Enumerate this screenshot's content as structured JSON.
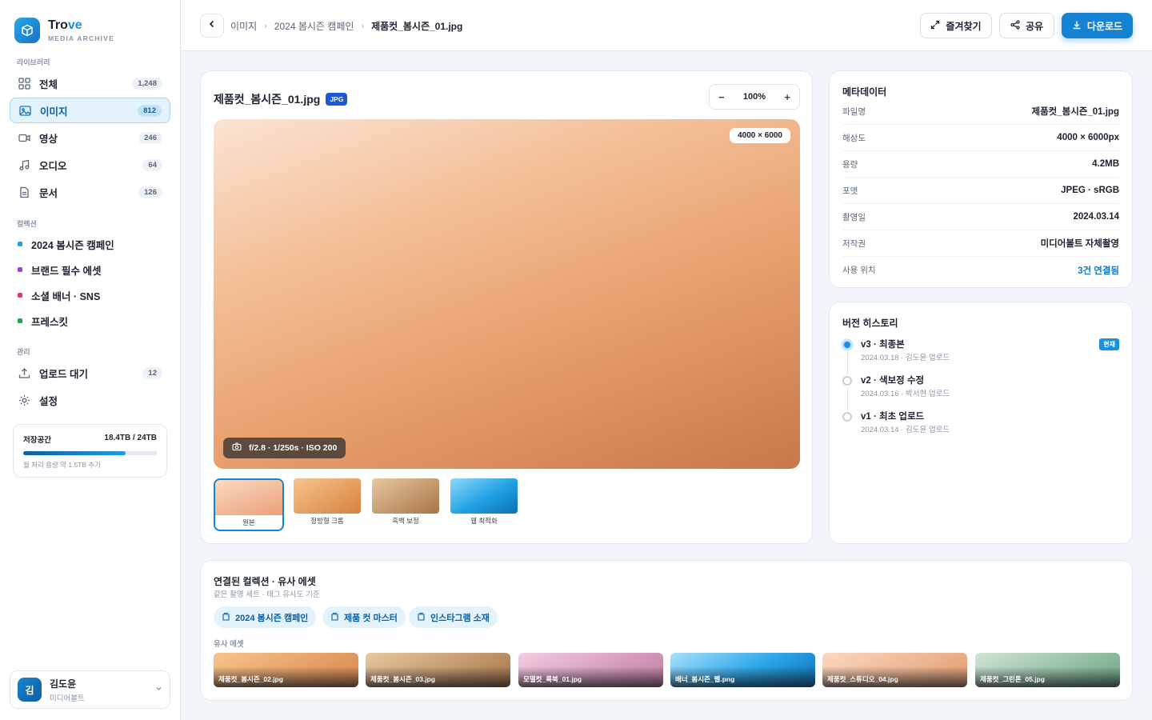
{
  "brand": {
    "name_main": "Tro",
    "name_accent": "ve",
    "sub": "MEDIA ARCHIVE"
  },
  "sidebar": {
    "library_label": "라이브러리",
    "library": [
      {
        "label": "전체",
        "count": "1,248",
        "icon": "grid-icon"
      },
      {
        "label": "이미지",
        "count": "812",
        "icon": "image-icon",
        "active": true
      },
      {
        "label": "영상",
        "count": "246",
        "icon": "video-icon"
      },
      {
        "label": "오디오",
        "count": "64",
        "icon": "music-icon"
      },
      {
        "label": "문서",
        "count": "126",
        "icon": "document-icon"
      }
    ],
    "collections_label": "컬렉션",
    "collections": [
      {
        "label": "2024 봄시즌 캠페인",
        "color": "#1ba3d8"
      },
      {
        "label": "브랜드 필수 에셋",
        "color": "#9b3fd6"
      },
      {
        "label": "소셜 배너 · SNS",
        "color": "#e0357a"
      },
      {
        "label": "프레스킷",
        "color": "#22a34a"
      }
    ],
    "manage_label": "관리",
    "manage": [
      {
        "label": "업로드 대기",
        "count": "12",
        "icon": "upload-icon"
      },
      {
        "label": "설정",
        "icon": "settings-icon"
      }
    ],
    "storage": {
      "title": "저장공간",
      "value": "18.4TB / 24TB",
      "used_fraction": 0.767,
      "note": "월 처리 용량 약 1.5TB 추가"
    },
    "user": {
      "initial": "김",
      "name": "김도윤",
      "org": "미디어볼트"
    }
  },
  "topbar": {
    "breadcrumb": [
      "이미지",
      "2024 봄시즌 캠페인",
      "제품컷_봄시즌_01.jpg"
    ],
    "favorite_label": "즐겨찾기",
    "share_label": "공유",
    "download_label": "다운로드"
  },
  "preview": {
    "title": "제품컷_봄시즌_01.jpg",
    "format_chip": "JPG",
    "zoom": "100%",
    "zoom_minus": "−",
    "zoom_plus": "+",
    "resolution": "4000 × 6000",
    "exif": "f/2.8 · 1/250s · ISO 200",
    "thumbnails": [
      {
        "label": "원본",
        "active": true
      },
      {
        "label": "정방형 크롭"
      },
      {
        "label": "흑백 보정"
      },
      {
        "label": "웹 최적화"
      }
    ]
  },
  "metadata": {
    "title": "메타데이터",
    "rows": [
      {
        "key": "파일명",
        "value": "제품컷_봄시즌_01.jpg"
      },
      {
        "key": "해상도",
        "value": "4000 × 6000px"
      },
      {
        "key": "용량",
        "value": "4.2MB"
      },
      {
        "key": "포맷",
        "value": "JPEG · sRGB"
      },
      {
        "key": "촬영일",
        "value": "2024.03.14"
      },
      {
        "key": "저작권",
        "value": "미디어볼트 자체촬영"
      },
      {
        "key": "사용 위치",
        "value": "3건 연결됨"
      }
    ]
  },
  "versions": {
    "title": "버전 히스토리",
    "items": [
      {
        "title": "v3 · 최종본",
        "sub": "2024.03.18 · 김도윤 업로드",
        "tag": "현재"
      },
      {
        "title": "v2 · 색보정 수정",
        "sub": "2024.03.16 · 박서현 업로드"
      },
      {
        "title": "v1 · 최초 업로드",
        "sub": "2024.03.14 · 김도윤 업로드"
      }
    ]
  },
  "related": {
    "title": "연결된 컬렉션 · 유사 에셋",
    "sub": "같은 촬영 세트 · 태그 유사도 기준",
    "collections": [
      "2024 봄시즌 캠페인",
      "제품 컷 마스터",
      "인스타그램 소재"
    ],
    "similar_label": "유사 에셋",
    "assets": [
      {
        "label": "제품컷_봄시즌_02.jpg"
      },
      {
        "label": "제품컷_봄시즌_03.jpg"
      },
      {
        "label": "모델컷_룩북_01.jpg"
      },
      {
        "label": "배너_봄시즌_웹.png"
      },
      {
        "label": "제품컷_스튜디오_04.jpg"
      },
      {
        "label": "제품컷_그린톤_05.jpg"
      }
    ]
  }
}
